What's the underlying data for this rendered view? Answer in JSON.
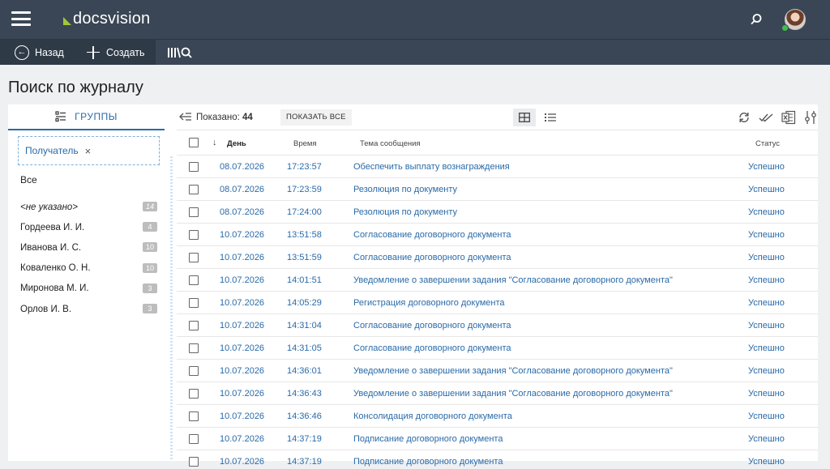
{
  "header": {
    "logo": "docsvision",
    "avatar_alt": ""
  },
  "toolbar": {
    "back_label": "Назад",
    "create_label": "Создать"
  },
  "page_title": "Поиск по журналу",
  "sidebar": {
    "tab_label": "ГРУППЫ",
    "filter_label": "Получатель",
    "filter_close": "×",
    "all_label": "Все",
    "items": [
      {
        "label": "<не указано>",
        "count": "14"
      },
      {
        "label": "Гордеева И. И.",
        "count": "4"
      },
      {
        "label": "Иванова И. С.",
        "count": "10"
      },
      {
        "label": "Коваленко О. Н.",
        "count": "10"
      },
      {
        "label": "Миронова М. И.",
        "count": "3"
      },
      {
        "label": "Орлов И. В.",
        "count": "3"
      }
    ]
  },
  "content": {
    "shown_label": "Показано:",
    "shown_count": "44",
    "show_all_label": "ПОКАЗАТЬ ВСЕ"
  },
  "table": {
    "columns": {
      "day": "День",
      "time": "Время",
      "subject": "Тема сообщения",
      "status": "Статус"
    },
    "rows": [
      {
        "day": "08.07.2026",
        "time": "17:23:57",
        "subject": "Обеспечить выплату вознаграждения",
        "status": "Успешно"
      },
      {
        "day": "08.07.2026",
        "time": "17:23:59",
        "subject": "Резолюция по документу",
        "status": "Успешно"
      },
      {
        "day": "08.07.2026",
        "time": "17:24:00",
        "subject": "Резолюция по документу",
        "status": "Успешно"
      },
      {
        "day": "10.07.2026",
        "time": "13:51:58",
        "subject": "Согласование договорного документа",
        "status": "Успешно"
      },
      {
        "day": "10.07.2026",
        "time": "13:51:59",
        "subject": "Согласование договорного документа",
        "status": "Успешно"
      },
      {
        "day": "10.07.2026",
        "time": "14:01:51",
        "subject": "Уведомление о завершении задания \"Согласование договорного документа\"",
        "status": "Успешно"
      },
      {
        "day": "10.07.2026",
        "time": "14:05:29",
        "subject": "Регистрация договорного документа",
        "status": "Успешно"
      },
      {
        "day": "10.07.2026",
        "time": "14:31:04",
        "subject": "Согласование договорного документа",
        "status": "Успешно"
      },
      {
        "day": "10.07.2026",
        "time": "14:31:05",
        "subject": "Согласование договорного документа",
        "status": "Успешно"
      },
      {
        "day": "10.07.2026",
        "time": "14:36:01",
        "subject": "Уведомление о завершении задания \"Согласование договорного документа\"",
        "status": "Успешно"
      },
      {
        "day": "10.07.2026",
        "time": "14:36:43",
        "subject": "Уведомление о завершении задания \"Согласование договорного документа\"",
        "status": "Успешно"
      },
      {
        "day": "10.07.2026",
        "time": "14:36:46",
        "subject": "Консолидация договорного документа",
        "status": "Успешно"
      },
      {
        "day": "10.07.2026",
        "time": "14:37:19",
        "subject": "Подписание договорного документа",
        "status": "Успешно"
      },
      {
        "day": "10.07.2026",
        "time": "14:37:19",
        "subject": "Подписание договорного документа",
        "status": "Успешно"
      }
    ]
  },
  "colors": {
    "header_bg": "#3a4655",
    "accent": "#2a6aa8",
    "logo_mark": "#a4c639",
    "online": "#3fbf4a"
  }
}
